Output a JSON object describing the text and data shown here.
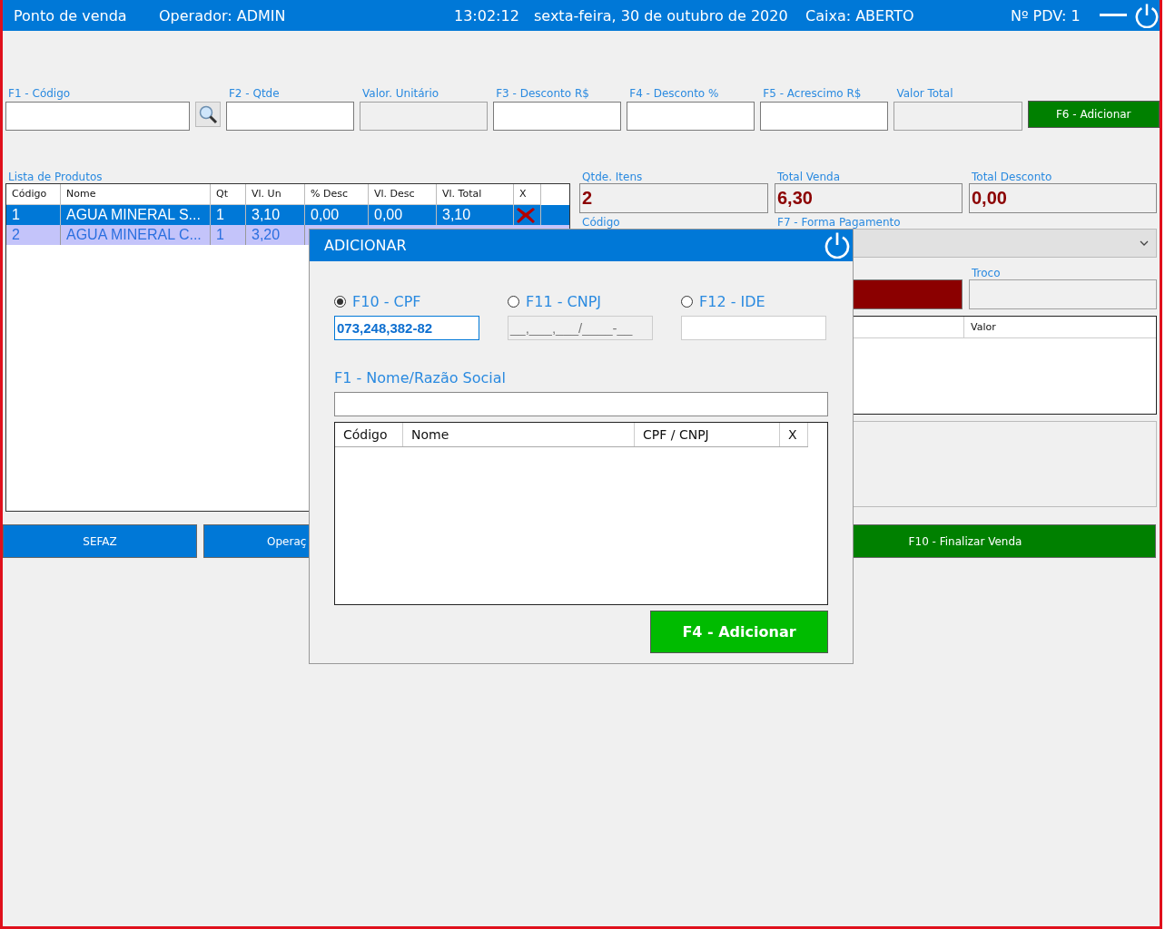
{
  "header": {
    "title": "Ponto de venda",
    "operator": "Operador: ADMIN",
    "time": "13:02:12",
    "date": "sexta-feira, 30 de outubro de 2020",
    "register_status": "Caixa: ABERTO",
    "pdv": "Nº PDV: 1"
  },
  "entry": [
    {
      "kind": "field",
      "label": "F1 - Código",
      "disabled": false
    },
    {
      "kind": "search-button"
    },
    {
      "kind": "field",
      "label": "F2 - Qtde",
      "disabled": false
    },
    {
      "kind": "field",
      "label": "Valor. Unitário",
      "disabled": true
    },
    {
      "kind": "field",
      "label": "F3 - Desconto R$",
      "disabled": false
    },
    {
      "kind": "field",
      "label": "F4 - Desconto  %",
      "disabled": false
    },
    {
      "kind": "field",
      "label": "F5 - Acrescimo R$",
      "disabled": false
    },
    {
      "kind": "field",
      "label": "Valor Total",
      "disabled": true
    },
    {
      "kind": "button",
      "label": "F6 - Adicionar"
    }
  ],
  "products": {
    "title": "Lista de Produtos",
    "columns": [
      "Código",
      "Nome",
      "Qt",
      "Vl. Un",
      "% Desc",
      "Vl. Desc",
      "Vl. Total",
      "X"
    ],
    "rows": [
      {
        "cells": [
          "1",
          "AGUA MINERAL S...",
          "1",
          "3,10",
          "0,00",
          "0,00",
          "3,10"
        ],
        "selected": true,
        "remove_icon": true
      },
      {
        "cells": [
          "2",
          "AGUA MINERAL C...",
          "1",
          "3,20"
        ],
        "selected": false,
        "remove_icon": false
      }
    ]
  },
  "summary": {
    "totals": [
      {
        "label": "Qtde. Itens",
        "value": "2"
      },
      {
        "label": "Total Venda",
        "value": "6,30"
      },
      {
        "label": "Total Desconto",
        "value": "0,00"
      }
    ],
    "code_label": "Código",
    "payment_label": "F7 - Forma Pagamento",
    "change_label": "Troco",
    "payments_columns": [
      "Valor"
    ]
  },
  "actions": [
    {
      "label": "SEFAZ",
      "kind": "primary"
    },
    {
      "label": "Operaç",
      "kind": "primary"
    },
    {
      "label": "F10 - Finalizar Venda",
      "kind": "success"
    }
  ],
  "dialog": {
    "title": "ADICIONAR",
    "options": [
      {
        "label": "F10 - CPF",
        "selected": true,
        "value": "073,248,382-82",
        "disabled": false
      },
      {
        "label": "F11 - CNPJ",
        "selected": false,
        "placeholder": "__,___,___/____-__",
        "disabled": true
      },
      {
        "label": "F12 - IDE",
        "selected": false,
        "disabled": false
      }
    ],
    "name_label": "F1 - Nome/Razão Social",
    "columns": [
      "Código",
      "Nome",
      "CPF / CNPJ",
      "X"
    ],
    "button": "F4 - Adicionar"
  }
}
